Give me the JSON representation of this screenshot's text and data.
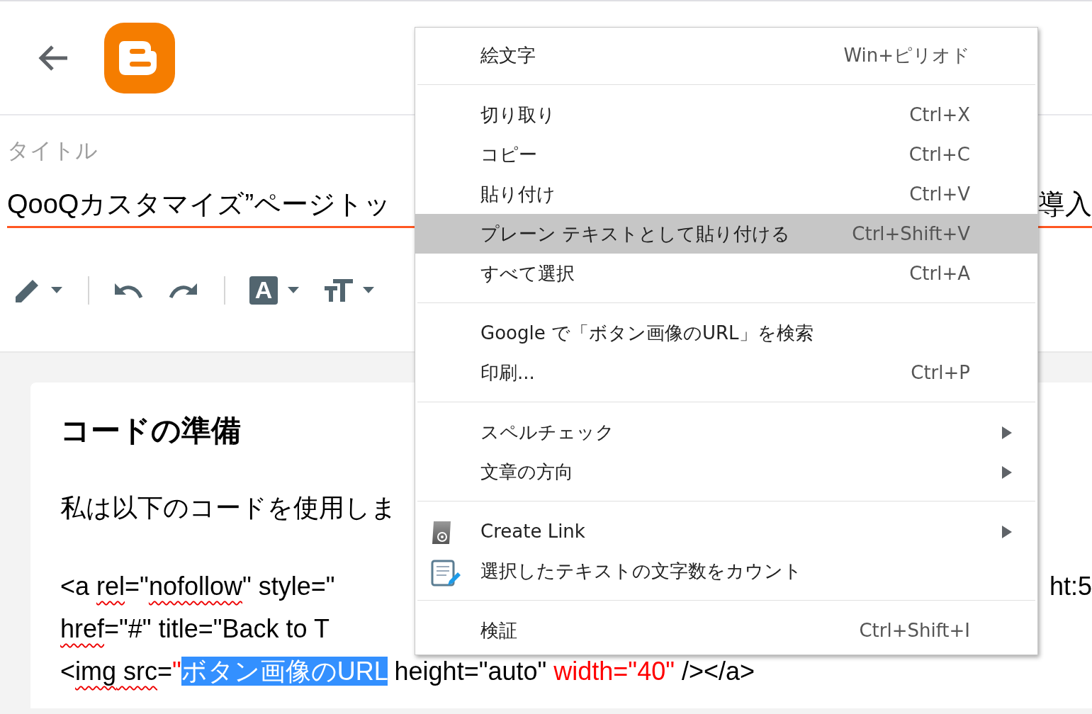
{
  "title_field": {
    "label": "タイトル",
    "value_left": "QooQカスタマイズ”ページトッ",
    "value_right": "導入"
  },
  "toolbar": {
    "text_color_letter": "A"
  },
  "post": {
    "heading": "コードの準備",
    "paragraph": "私は以下のコードを使用しま",
    "code_lines": [
      {
        "segments": [
          {
            "text": "<a ",
            "kind": "plain"
          },
          {
            "text": "rel",
            "kind": "misspelled"
          },
          {
            "text": "=\"",
            "kind": "plain"
          },
          {
            "text": "nofollow",
            "kind": "misspelled"
          },
          {
            "text": "\" style=\"",
            "kind": "plain"
          }
        ],
        "right_text": "ht:5"
      },
      {
        "segments": [
          {
            "text": "href",
            "kind": "misspelled"
          },
          {
            "text": "=\"#\" title=\"Back to T",
            "kind": "plain"
          }
        ]
      },
      {
        "segments": [
          {
            "text": "<",
            "kind": "plain"
          },
          {
            "text": "img",
            "kind": "misspelled"
          },
          {
            "text": " src",
            "kind": "misspelled"
          },
          {
            "text": "=",
            "kind": "plain"
          },
          {
            "text": "\"",
            "kind": "red"
          },
          {
            "text": "ボタン画像のURL",
            "kind": "selected"
          },
          {
            "text": " height=\"auto\" ",
            "kind": "plain"
          },
          {
            "text": "width=\"40\"",
            "kind": "red"
          },
          {
            "text": " /></a>",
            "kind": "plain"
          }
        ]
      }
    ]
  },
  "context_menu": {
    "items": [
      {
        "kind": "item",
        "label": "絵文字",
        "shortcut": "Win+ピリオド",
        "submenu": false,
        "selected": false
      },
      {
        "kind": "separator"
      },
      {
        "kind": "item",
        "label": "切り取り",
        "shortcut": "Ctrl+X",
        "submenu": false,
        "selected": false
      },
      {
        "kind": "item",
        "label": "コピー",
        "shortcut": "Ctrl+C",
        "submenu": false,
        "selected": false
      },
      {
        "kind": "item",
        "label": "貼り付け",
        "shortcut": "Ctrl+V",
        "submenu": false,
        "selected": false
      },
      {
        "kind": "item",
        "label": "プレーン テキストとして貼り付ける",
        "shortcut": "Ctrl+Shift+V",
        "submenu": false,
        "selected": true
      },
      {
        "kind": "item",
        "label": "すべて選択",
        "shortcut": "Ctrl+A",
        "submenu": false,
        "selected": false
      },
      {
        "kind": "separator"
      },
      {
        "kind": "item",
        "label": "Google で「ボタン画像のURL」を検索",
        "submenu": false,
        "selected": false
      },
      {
        "kind": "item",
        "label": "印刷...",
        "shortcut": "Ctrl+P",
        "submenu": false,
        "selected": false
      },
      {
        "kind": "separator"
      },
      {
        "kind": "item",
        "label": "スペルチェック",
        "submenu": true,
        "selected": false
      },
      {
        "kind": "item",
        "label": "文章の方向",
        "submenu": true,
        "selected": false
      },
      {
        "kind": "separator"
      },
      {
        "kind": "link_item",
        "label": "Create Link",
        "submenu": true,
        "selected": false
      },
      {
        "kind": "count_item",
        "label": "選択したテキストの文字数をカウント",
        "submenu": false,
        "selected": false
      },
      {
        "kind": "separator"
      },
      {
        "kind": "item",
        "label": "検証",
        "shortcut": "Ctrl+Shift+I",
        "submenu": false,
        "selected": false
      }
    ]
  }
}
